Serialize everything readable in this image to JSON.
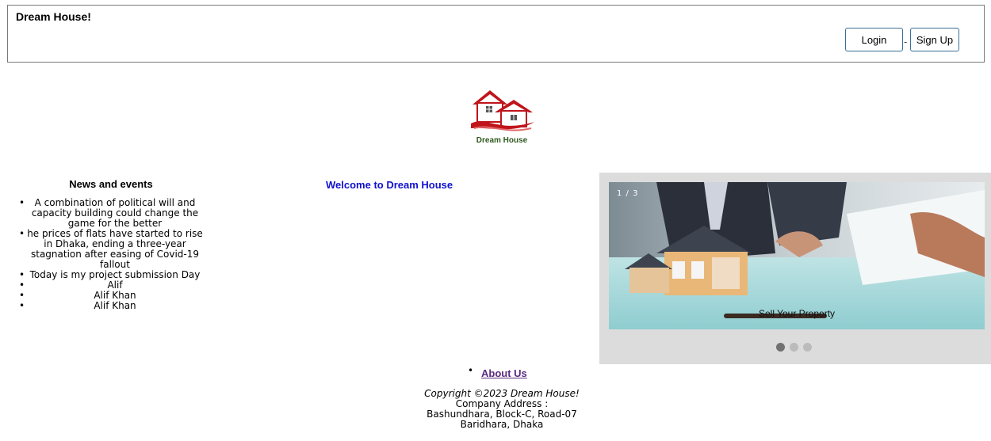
{
  "header": {
    "brand": "Dream House!",
    "login_label": "Login",
    "separator": "-",
    "signup_label": "Sign Up"
  },
  "logo": {
    "caption": "Dream House"
  },
  "news": {
    "title": "News and events",
    "items": [
      "A combination of political will and capacity building could change the game for the better",
      "he prices of flats have started to rise in Dhaka, ending a three-year stagnation after easing of Covid-19 fallout",
      "Today is my project submission Day",
      "Alif",
      "Alif Khan",
      "Alif Khan"
    ]
  },
  "welcome": "Welcome to Dream House",
  "slider": {
    "counter": "1 / 3",
    "caption": "Sell Your Property",
    "active_index": 1,
    "total": 3
  },
  "footer": {
    "about_label": "About Us",
    "copyright": "Copyright ©2023 Dream House!",
    "address_label": "Company Address :",
    "address_line1": "Bashundhara, Block-C, Road-07",
    "address_line2": "Baridhara, Dhaka"
  }
}
